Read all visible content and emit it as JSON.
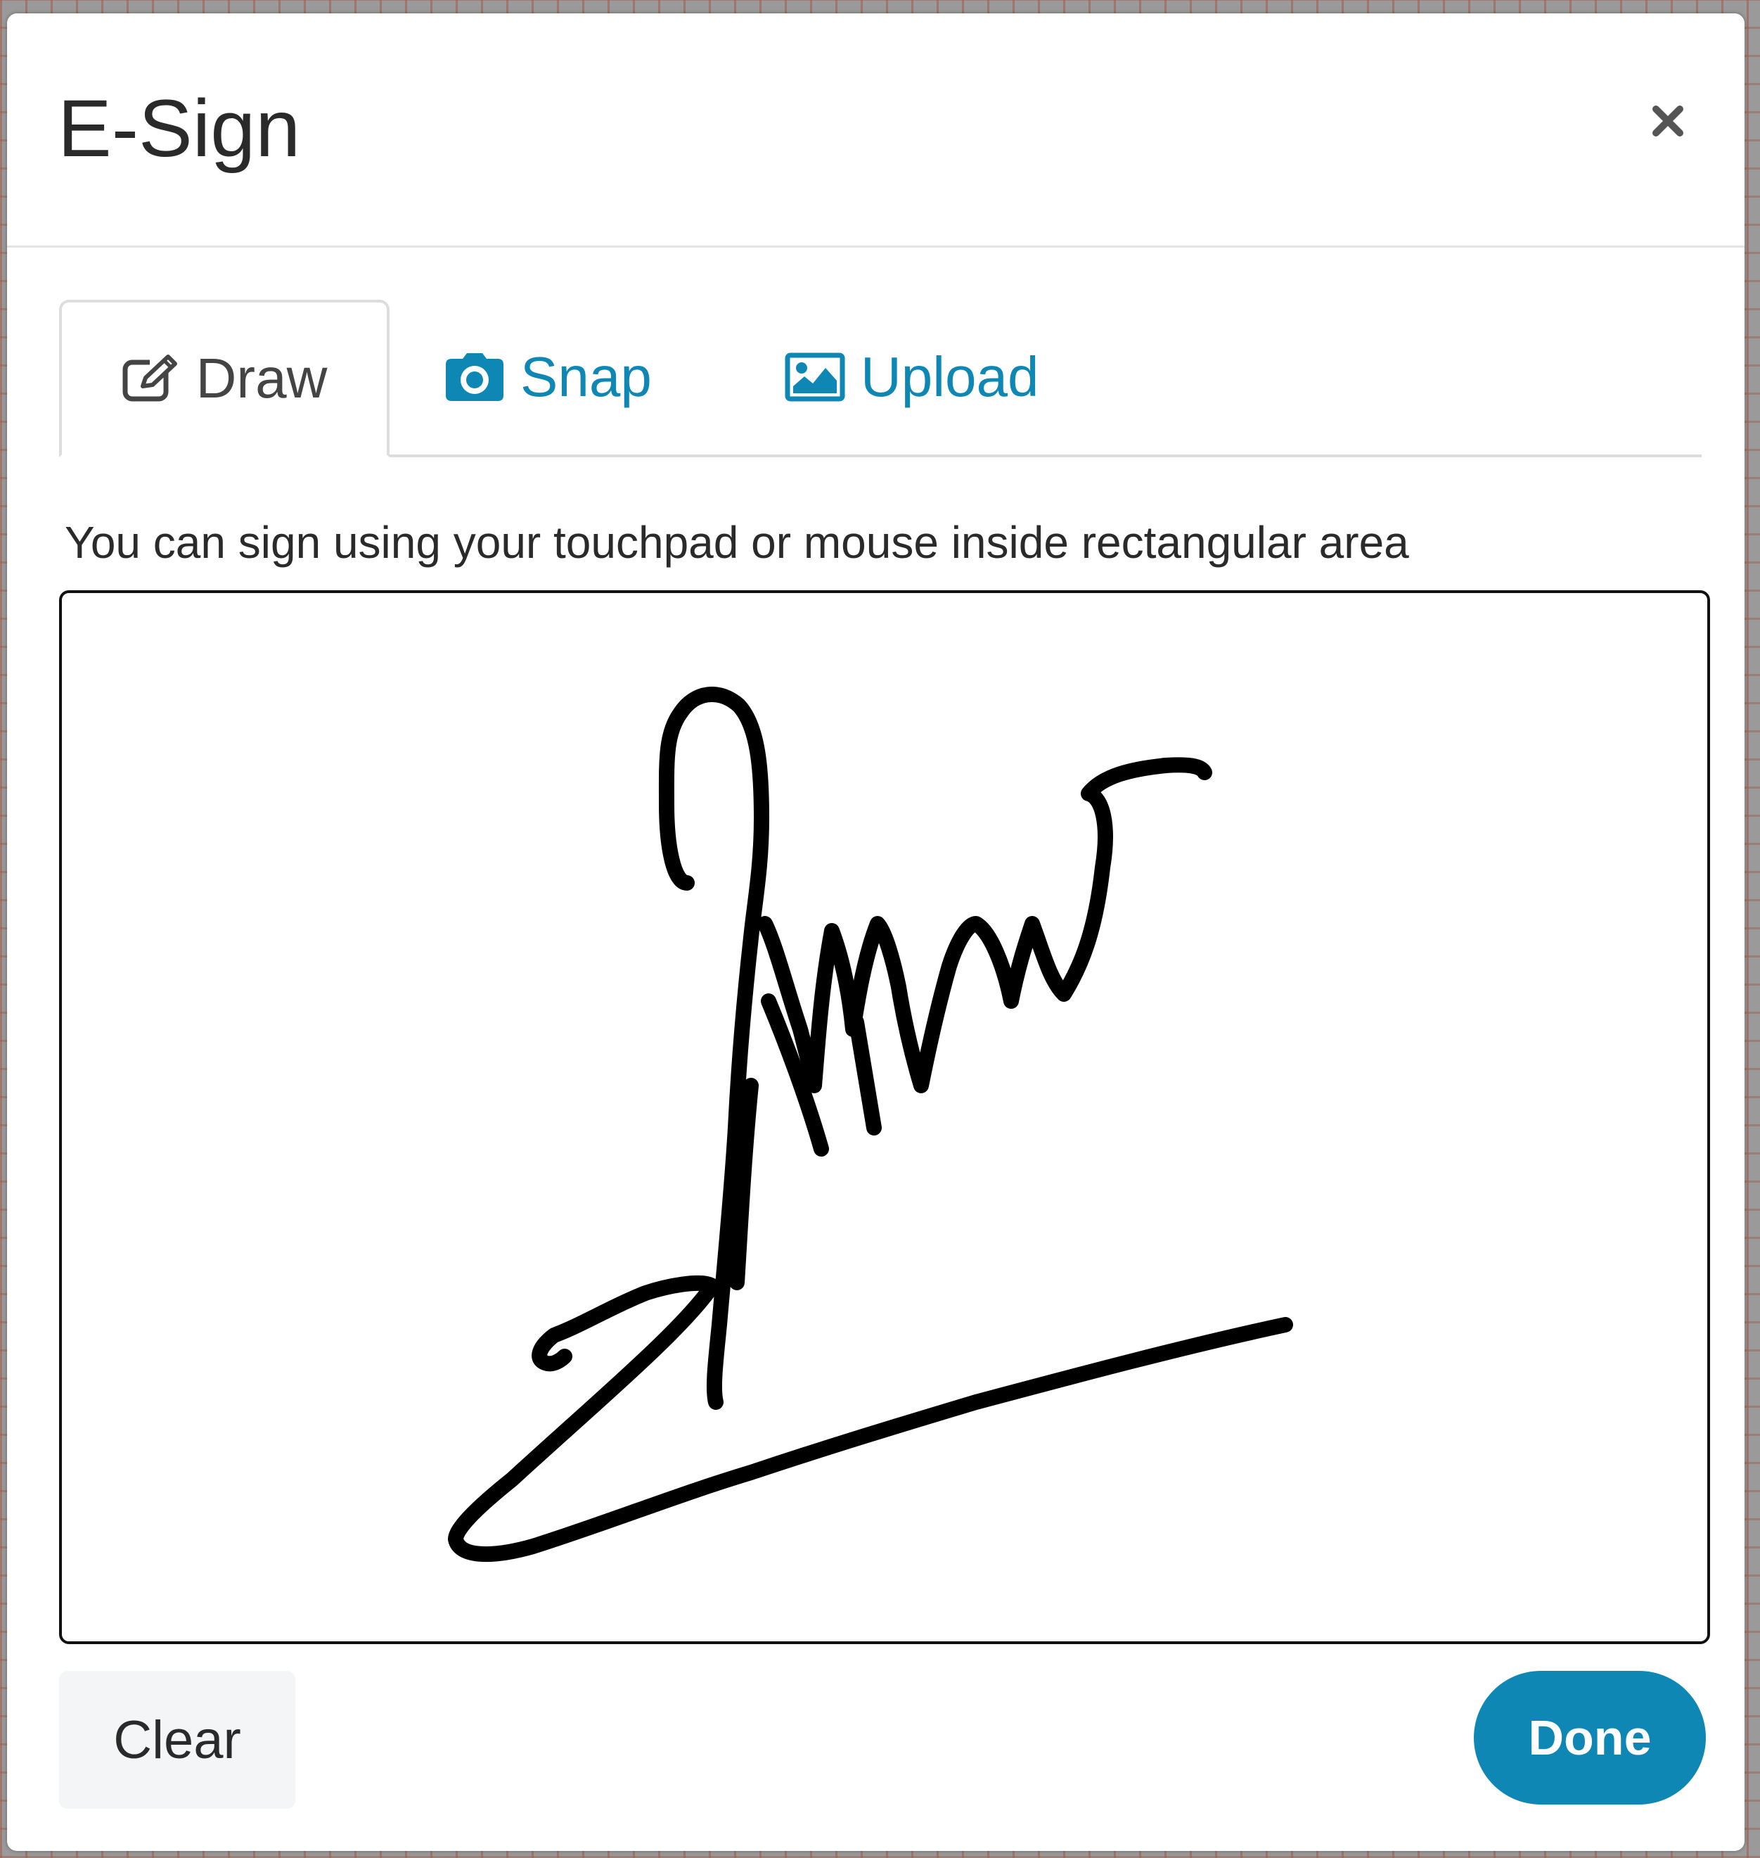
{
  "modal": {
    "title": "E-Sign",
    "close_icon": "close-icon"
  },
  "tabs": [
    {
      "label": "Draw",
      "icon": "pencil-square-icon",
      "active": true
    },
    {
      "label": "Snap",
      "icon": "camera-icon",
      "active": false
    },
    {
      "label": "Upload",
      "icon": "image-icon",
      "active": false
    }
  ],
  "instructions": "You can sign using your touchpad or mouse inside rectangular area",
  "buttons": {
    "clear_label": "Clear",
    "done_label": "Done"
  },
  "colors": {
    "accent": "#0e87b5",
    "title_text": "#2a2a2a",
    "signature_ink": "#000000"
  }
}
